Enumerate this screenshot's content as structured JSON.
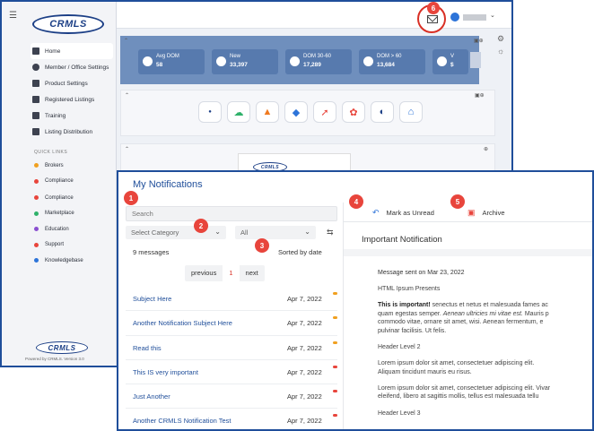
{
  "brand": {
    "logo_text": "CRMLS",
    "powered_by": "Powered by CRMLS. Version 3.0"
  },
  "sidebar": {
    "items": [
      {
        "label": "Home",
        "icon": "home-icon"
      },
      {
        "label": "Member / Office Settings",
        "icon": "gear-icon"
      },
      {
        "label": "Product Settings",
        "icon": "box-icon"
      },
      {
        "label": "Registered Listings",
        "icon": "list-icon"
      },
      {
        "label": "Training",
        "icon": "training-icon"
      },
      {
        "label": "Listing Distribution",
        "icon": "distribution-icon"
      }
    ],
    "quick_links_title": "QUICK LINKS",
    "quick_links": [
      {
        "label": "Brokers",
        "color": "#f0a020"
      },
      {
        "label": "Compliance",
        "color": "#e8453c"
      },
      {
        "label": "Compliance",
        "color": "#e8453c"
      },
      {
        "label": "Marketplace",
        "color": "#2fb16a"
      },
      {
        "label": "Education",
        "color": "#8a4fd0"
      },
      {
        "label": "Support",
        "color": "#e8453c"
      },
      {
        "label": "Knowledgebase",
        "color": "#2d74d9"
      }
    ]
  },
  "kpis": [
    {
      "label": "Avg DOM",
      "value": "58"
    },
    {
      "label": "New",
      "value": "33,397"
    },
    {
      "label": "DOM 30-60",
      "value": "17,289"
    },
    {
      "label": "DOM > 60",
      "value": "13,684"
    },
    {
      "label": "V",
      "value": "$"
    }
  ],
  "apps": [
    "crmls-logo-icon",
    "cloud-icon",
    "chart-icon",
    "diamond-icon",
    "graph-icon",
    "flower-icon",
    "gauge-icon",
    "home-pin-icon"
  ],
  "notifications": {
    "title": "My Notifications",
    "search_placeholder": "Search",
    "category_placeholder": "Select Category",
    "filter_value": "All",
    "message_count": "9 messages",
    "sorted_by": "Sorted by date",
    "pager": {
      "previous": "previous",
      "current": "1",
      "next": "next"
    },
    "items": [
      {
        "subject": "Subject Here",
        "date": "Apr 7, 2022",
        "dot": "#f0a020"
      },
      {
        "subject": "Another Notification Subject Here",
        "date": "Apr 7, 2022",
        "dot": "#f0a020"
      },
      {
        "subject": "Read this",
        "date": "Apr 7, 2022",
        "dot": "#f0a020"
      },
      {
        "subject": "This IS very important",
        "date": "Apr 7, 2022",
        "dot": "#e8453c"
      },
      {
        "subject": "Just Another",
        "date": "Apr 7, 2022",
        "dot": "#e8453c"
      },
      {
        "subject": "Another CRMLS Notification Test",
        "date": "Apr 7, 2022",
        "dot": "#e8453c"
      }
    ],
    "actions": {
      "mark_unread": "Mark as Unread",
      "archive": "Archive"
    },
    "detail": {
      "heading": "Important Notification",
      "sent": "Message sent on Mar 23, 2022",
      "intro": "HTML Ipsum Presents",
      "para1_bold": "This is important!",
      "para1_line1": " senectus et netus et malesuada fames ac",
      "para1_line2a": "quam egestas semper. ",
      "para1_line2_italic": "Aenean ultricies mi vitae est.",
      "para1_line2b": " Mauris p",
      "para1_line3": "commodo vitae, ornare sit amet, wisi. Aenean fermentum, e",
      "para1_line4": "pulvinar facilisis. Ut felis.",
      "h2": "Header Level 2",
      "para2_line1": "Lorem ipsum dolor sit amet, consectetuer adipiscing elit.",
      "para2_line2": "Aliquam tincidunt mauris eu risus.",
      "para3_line1": "Lorem ipsum dolor sit amet, consectetuer adipiscing elit. Vivar",
      "para3_line2": "eleifend, libero at sagittis mollis, tellus est malesuada tellu",
      "h3": "Header Level 3"
    }
  },
  "badges": [
    "1",
    "2",
    "3",
    "4",
    "5",
    "6"
  ],
  "colors": {
    "accent": "#1f4e9a",
    "badge": "#e8453c",
    "kpi_band": "#6f8fbd"
  }
}
